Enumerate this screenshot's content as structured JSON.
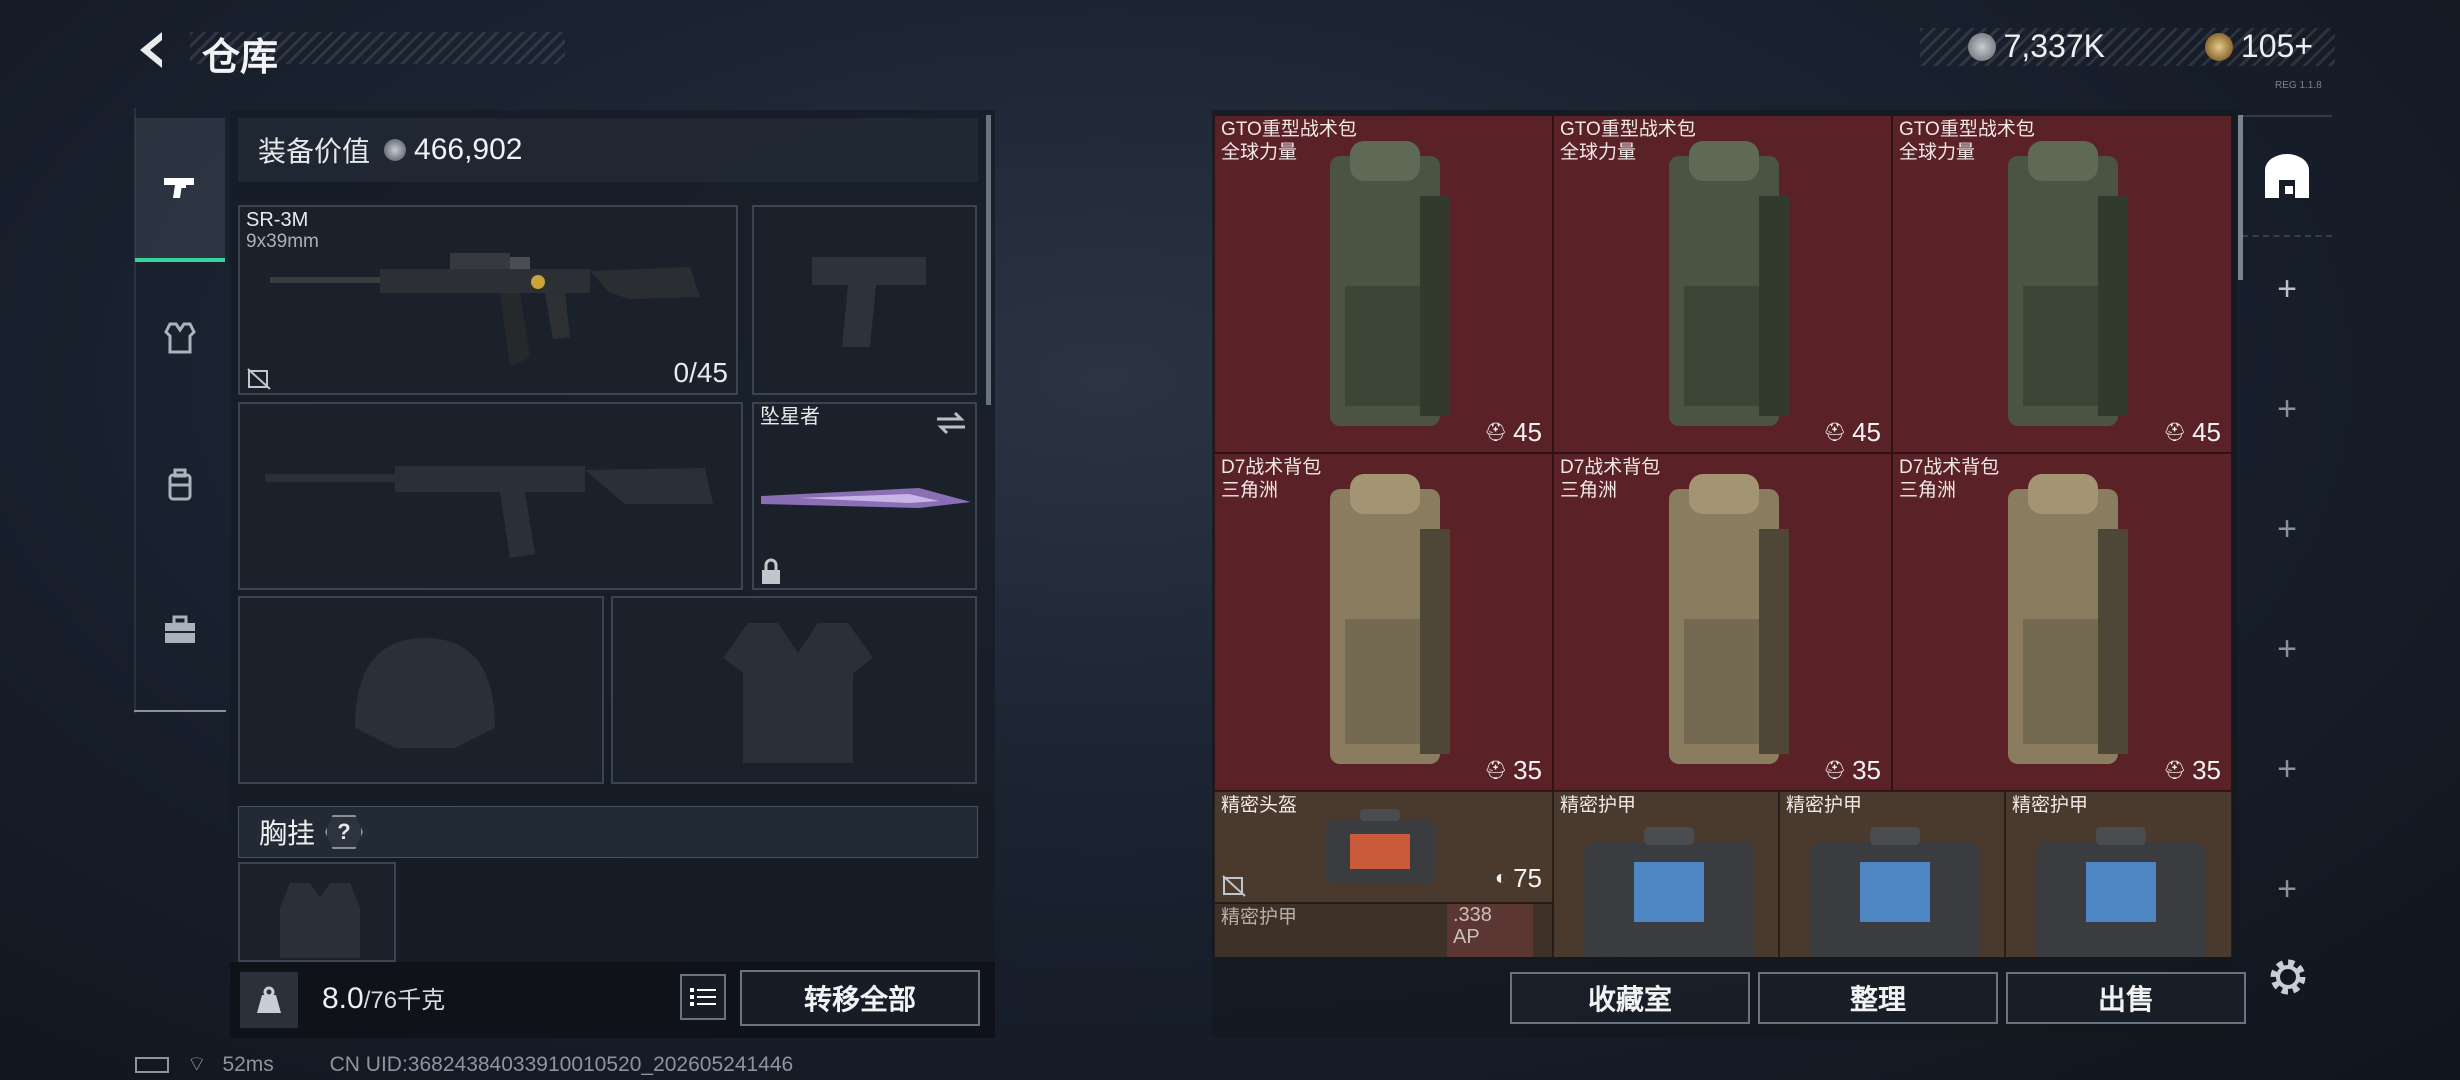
{
  "header": {
    "title": "仓库",
    "back_icon": "back-arrow-icon"
  },
  "currency": {
    "primary": "7,337K",
    "secondary": "105+",
    "small_tag": "REG 1.1.8"
  },
  "tabs": [
    {
      "name": "weapon",
      "icon": "pistol-icon",
      "active": true
    },
    {
      "name": "armor",
      "icon": "vest-icon"
    },
    {
      "name": "backpack",
      "icon": "backpack-icon"
    },
    {
      "name": "case",
      "icon": "briefcase-icon"
    }
  ],
  "loadout": {
    "value_label": "装备价值",
    "value": "466,902",
    "primary_weapon": {
      "name": "SR-3M",
      "caliber": "9x39mm",
      "ammo": "0/45"
    },
    "melee": {
      "name": "坠星者"
    },
    "chest_rig_label": "胸挂",
    "chest_rig_help": "?"
  },
  "bottom": {
    "weight": "8.0",
    "weight_max": "/76千克",
    "transfer_all": "转移全部"
  },
  "storage": {
    "rows": [
      [
        {
          "name": "GTO重型战术包",
          "brand": "全球力量",
          "count": "45"
        },
        {
          "name": "GTO重型战术包",
          "brand": "全球力量",
          "count": "45"
        },
        {
          "name": "GTO重型战术包",
          "brand": "全球力量",
          "count": "45"
        }
      ],
      [
        {
          "name": "D7战术背包",
          "brand": "三角洲",
          "count": "35"
        },
        {
          "name": "D7战术背包",
          "brand": "三角洲",
          "count": "35"
        },
        {
          "name": "D7战术背包",
          "brand": "三角洲",
          "count": "35"
        }
      ]
    ],
    "helmet": {
      "name": "精密头盔",
      "count": "75"
    },
    "armors": [
      {
        "name": "精密护甲"
      },
      {
        "name": "精密护甲"
      },
      {
        "name": "精密护甲"
      }
    ],
    "partial": {
      "name": "精密护甲",
      "caliber": ".338",
      "tag": "AP"
    }
  },
  "actions": {
    "vault": "收藏室",
    "sort": "整理",
    "sell": "出售"
  },
  "status": {
    "ping": "52ms",
    "uid": "CN UID:36824384033910010520_202605241446"
  }
}
